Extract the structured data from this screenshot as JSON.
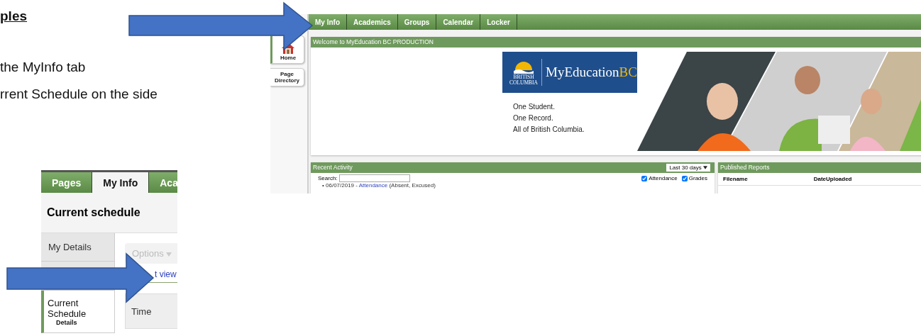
{
  "document": {
    "heading": "ples",
    "lines": [
      "the MyInfo tab",
      "rrent Schedule on the side"
    ]
  },
  "screenshot_1": {
    "tabs": [
      {
        "label": "My Info",
        "selected": false
      },
      {
        "label": "Academics",
        "selected": false
      },
      {
        "label": "Groups",
        "selected": false
      },
      {
        "label": "Calendar",
        "selected": false
      },
      {
        "label": "Locker",
        "selected": false
      }
    ],
    "sidebar": [
      {
        "label": "Home",
        "kind": "home"
      },
      {
        "label": "Page Directory",
        "kind": "plain"
      }
    ],
    "welcome_title": "Welcome to MyEducation BC PRODUCTION",
    "banner": {
      "brand_top": "BRITISH",
      "brand_bottom": "COLUMBIA",
      "wordmark": "MyEducation",
      "wordmark_suffix": "BC",
      "tagline": [
        "One Student.",
        "One Record.",
        "All of British Columbia."
      ]
    },
    "recent_activity": {
      "title": "Recent Activity",
      "range": "Last 30 days",
      "search_label": "Search:",
      "filters": [
        {
          "label": "Attendance",
          "checked": true
        },
        {
          "label": "Grades",
          "checked": true
        }
      ],
      "items": [
        {
          "bullet": "•",
          "date": "06/07/2019",
          "separator": "-",
          "link": "Attendance",
          "note": "(Absent, Excused)"
        }
      ]
    },
    "published_reports": {
      "title": "Published Reports",
      "columns": [
        "Filename",
        "DateUploaded"
      ]
    }
  },
  "screenshot_2": {
    "tabs": [
      {
        "label": "Pages",
        "selected": false
      },
      {
        "label": "My Info",
        "selected": true
      },
      {
        "label": "Aca",
        "selected": false
      }
    ],
    "title": "Current schedule",
    "sidebar": [
      {
        "label": "My Details",
        "selected": false
      },
      {
        "label": "Current Schedule",
        "sub": "Details",
        "selected": true
      }
    ],
    "options_button": {
      "label": "Options",
      "disabled": true
    },
    "view_link": "t view",
    "columns": [
      "Time"
    ]
  }
}
